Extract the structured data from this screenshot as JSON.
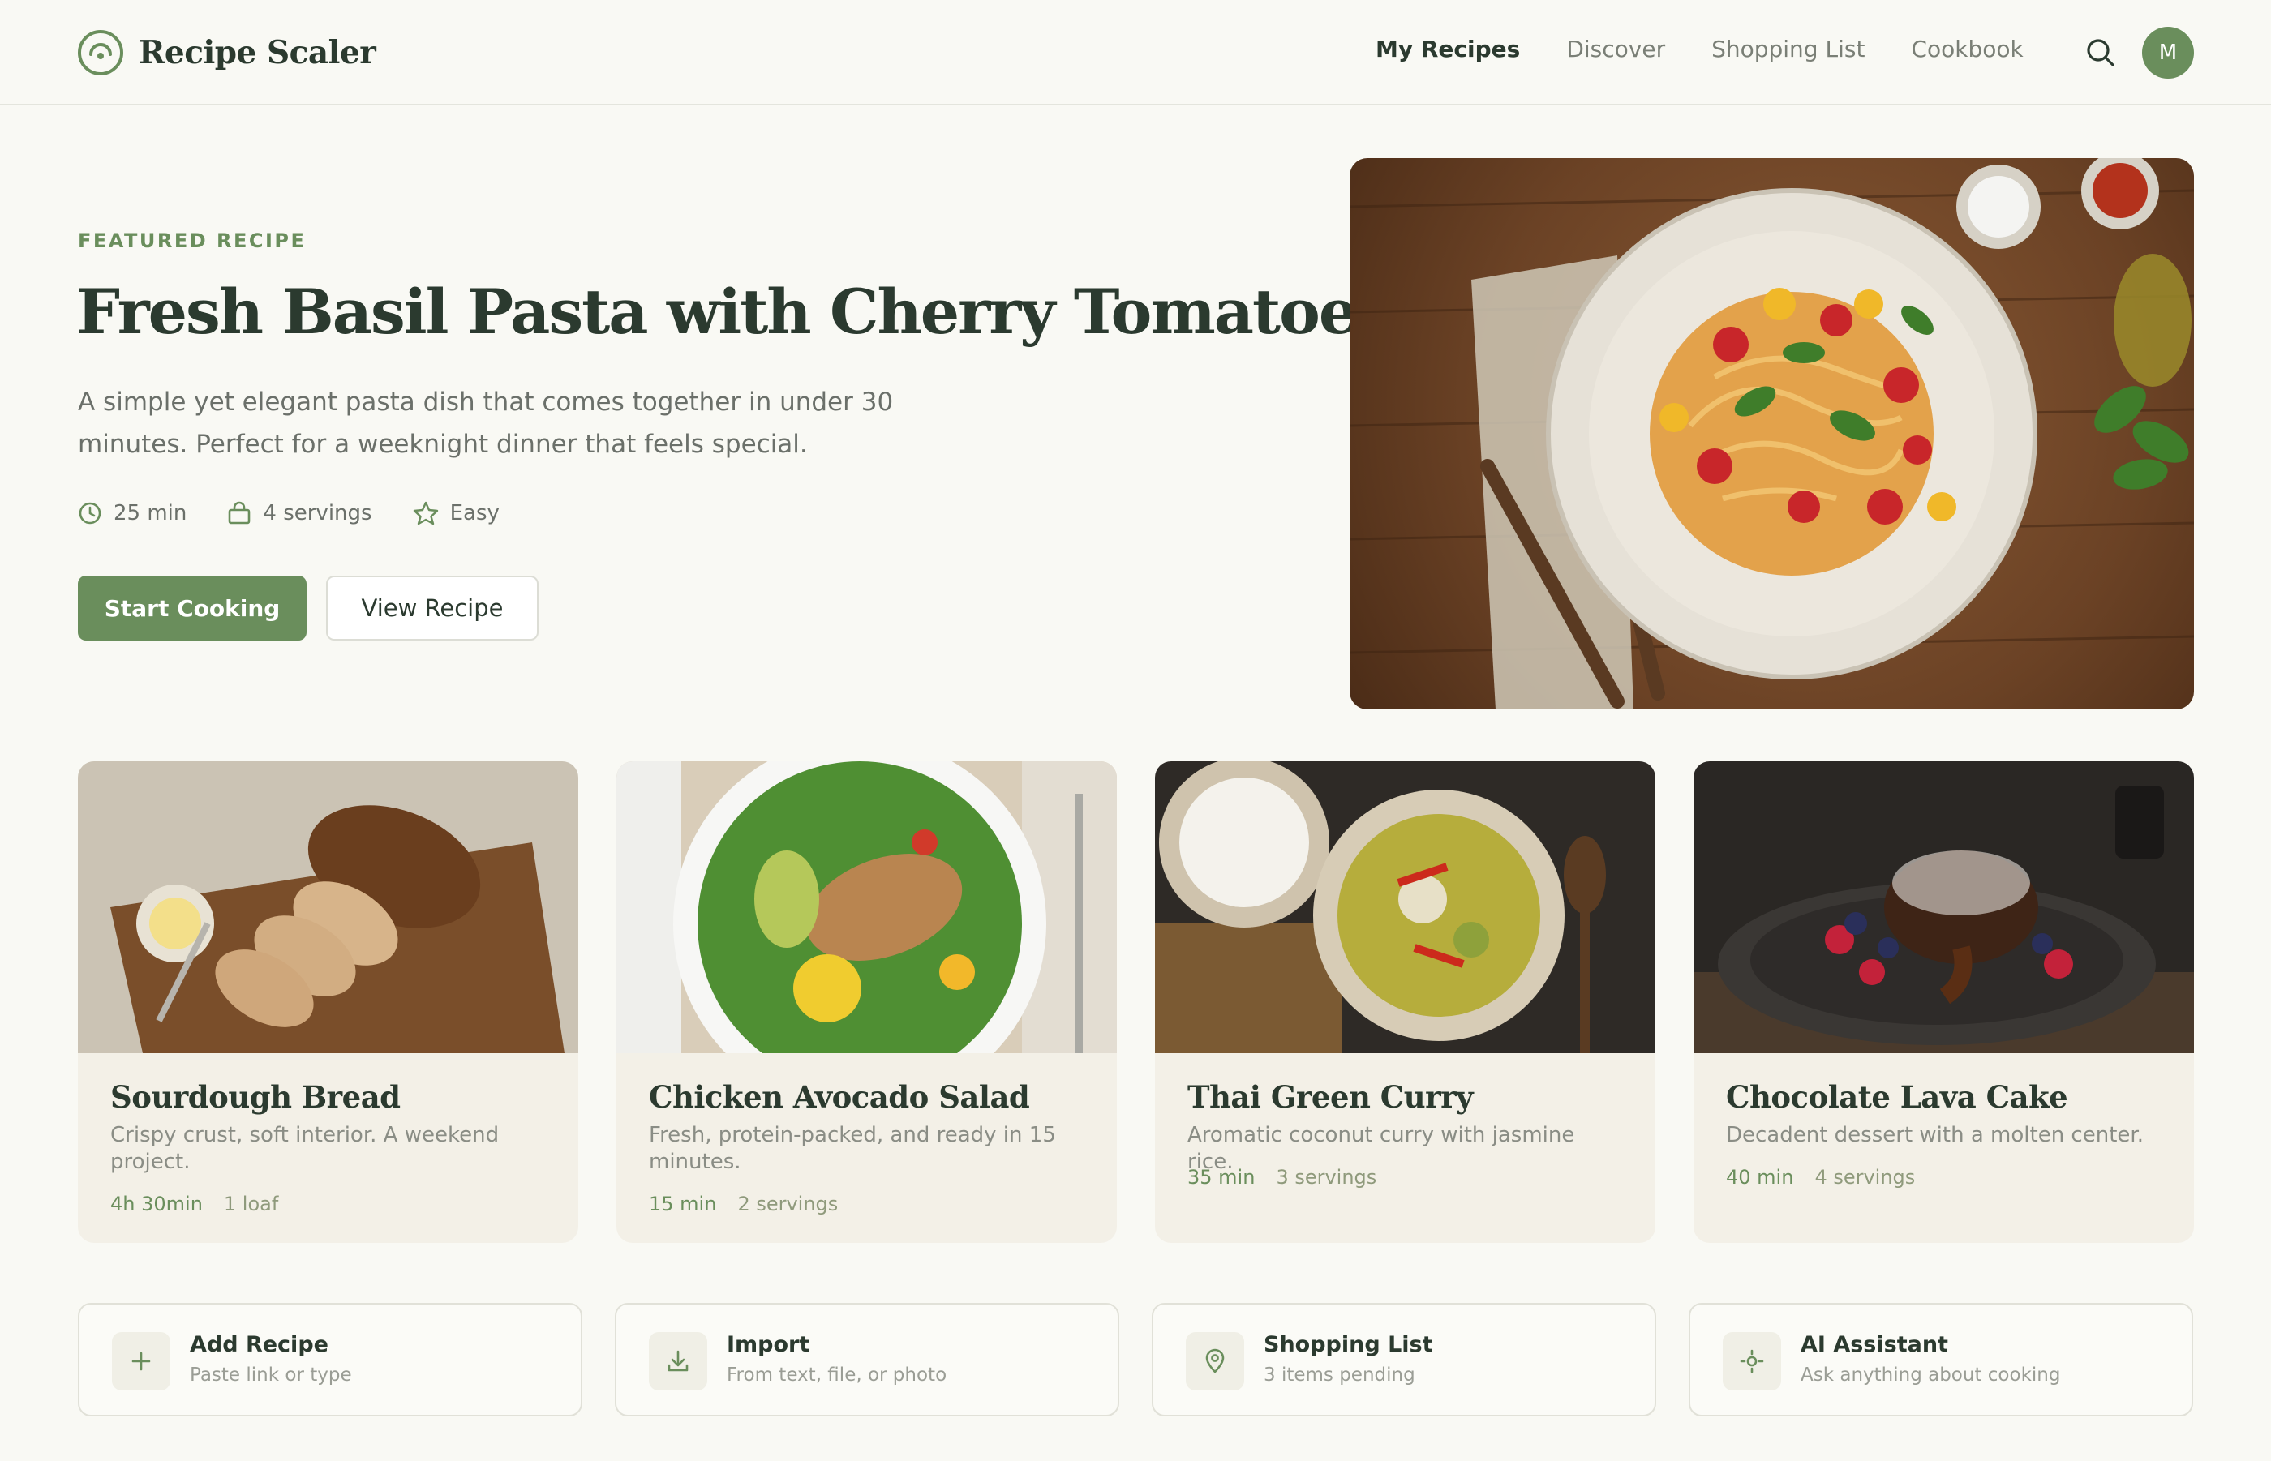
{
  "header": {
    "app_name": "Recipe Scaler",
    "nav": [
      {
        "label": "My Recipes",
        "active": true
      },
      {
        "label": "Discover",
        "active": false
      },
      {
        "label": "Shopping List",
        "active": false
      },
      {
        "label": "Cookbook",
        "active": false
      }
    ],
    "search_icon": "search-icon",
    "avatar_initial": "M"
  },
  "hero": {
    "eyebrow": "FEATURED RECIPE",
    "title": "Fresh Basil Pasta with Cherry Tomatoes",
    "description": "A simple yet elegant pasta dish that comes together in under 30 minutes. Perfect for a weeknight dinner that feels special.",
    "meta": {
      "time": "25 min",
      "servings": "4 servings",
      "difficulty": "Easy"
    },
    "primary_button": "Start Cooking",
    "secondary_button": "View Recipe"
  },
  "cards": [
    {
      "title": "Sourdough Bread",
      "description": "Crispy crust, soft interior. A weekend project.",
      "time": "4h 30min",
      "yield": "1 loaf"
    },
    {
      "title": "Chicken Avocado Salad",
      "description": "Fresh, protein-packed, and ready in 15 minutes.",
      "time": "15 min",
      "yield": "2 servings"
    },
    {
      "title": "Thai Green Curry",
      "description": "Aromatic coconut curry with jasmine rice.",
      "time": "35 min",
      "yield": "3 servings"
    },
    {
      "title": "Chocolate Lava Cake",
      "description": "Decadent dessert with a molten center.",
      "time": "40 min",
      "yield": "4 servings"
    }
  ],
  "actions": [
    {
      "title": "Add Recipe",
      "subtitle": "Paste link or type",
      "icon": "plus-icon"
    },
    {
      "title": "Import",
      "subtitle": "From text, file, or photo",
      "icon": "download-icon"
    },
    {
      "title": "Shopping List",
      "subtitle": "3 items pending",
      "icon": "location-pin-icon"
    },
    {
      "title": "AI Assistant",
      "subtitle": "Ask anything about cooking",
      "icon": "sparkle-icon"
    }
  ],
  "colors": {
    "accent": "#6a8e5c",
    "background": "#f9f9f4",
    "text": "#2b3a2f"
  }
}
